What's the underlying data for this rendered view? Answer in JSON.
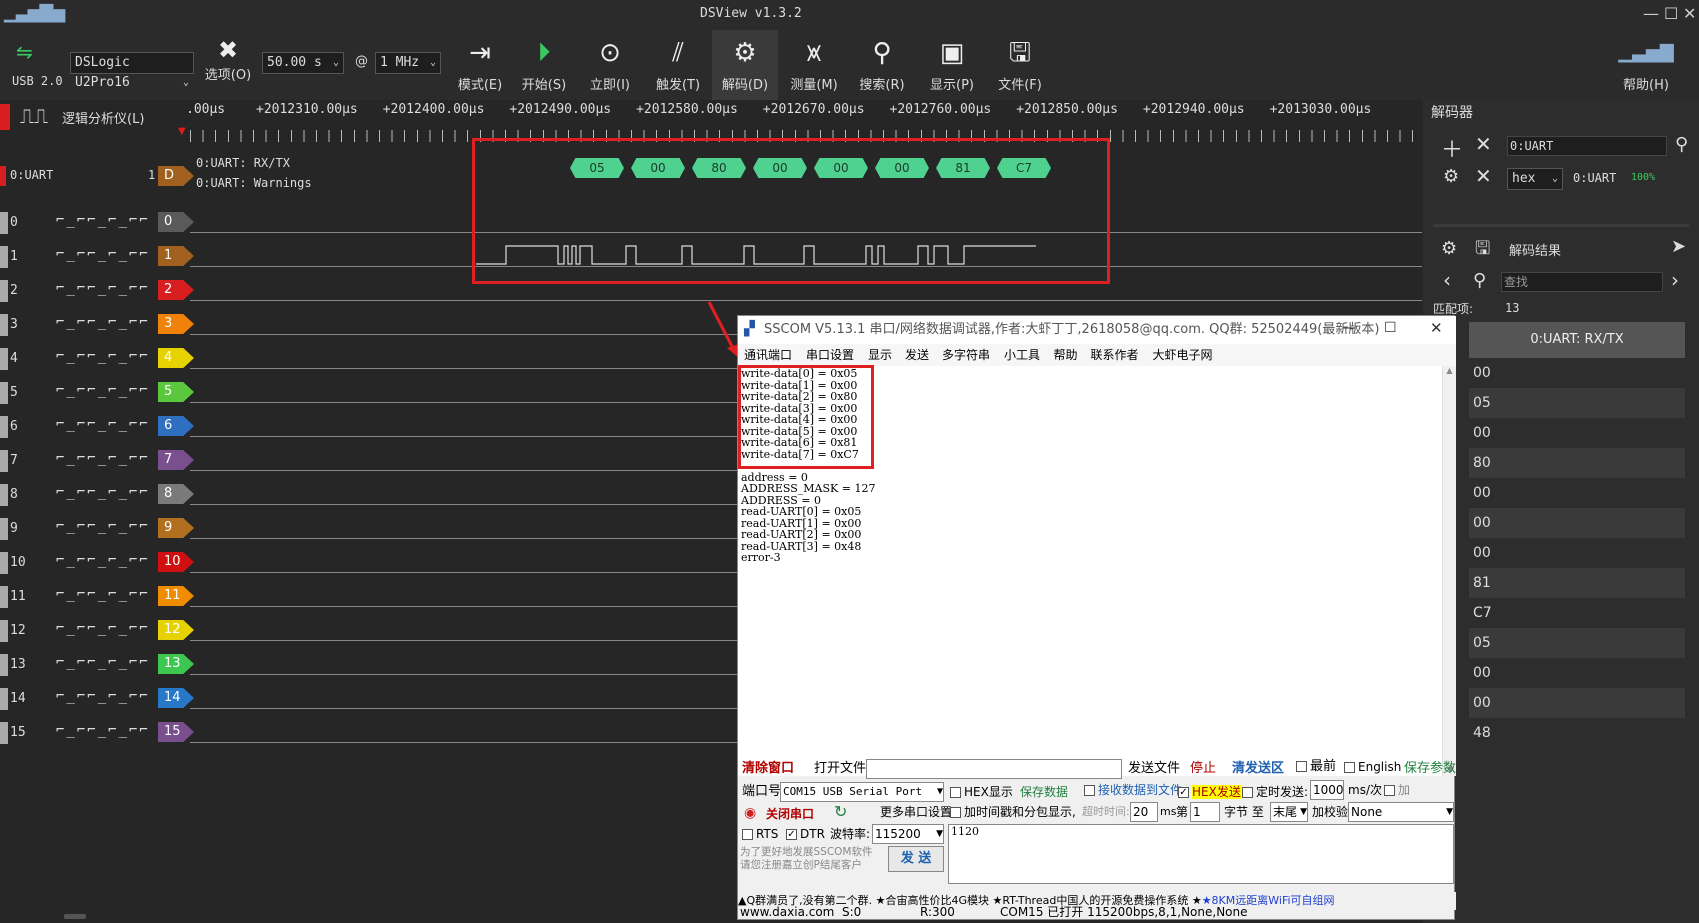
{
  "window": {
    "title": "DSView v1.3.2"
  },
  "toolbar": {
    "usb_label": "USB 2.0",
    "device": "DSLogic U2Pro16",
    "duration": "50.00 s",
    "at": "@",
    "rate": "1 MHz",
    "options": "选项(O)",
    "mode": "模式(E)",
    "start": "开始(S)",
    "instant": "立即(I)",
    "trigger": "触发(T)",
    "decode": "解码(D)",
    "measure": "测量(M)",
    "search": "搜索(R)",
    "display": "显示(P)",
    "file": "文件(F)",
    "help": "帮助(H)"
  },
  "left": {
    "analyzer_label": "逻辑分析仪(L)",
    "uart_channel": "0:UART",
    "uart_num": "1",
    "uart_tag": "D",
    "decoder_rows": [
      "0:UART: RX/TX",
      "0:UART: Warnings"
    ]
  },
  "timeaxis": {
    "ticks": [
      ".00μs",
      "+2012310.00μs",
      "+2012400.00μs",
      "+2012490.00μs",
      "+2012580.00μs",
      "+2012670.00μs",
      "+2012760.00μs",
      "+2012850.00μs",
      "+2012940.00μs",
      "+2013030.00μs"
    ]
  },
  "channels": [
    "0",
    "1",
    "2",
    "3",
    "4",
    "5",
    "6",
    "7",
    "8",
    "9",
    "10",
    "11",
    "12",
    "13",
    "14",
    "15"
  ],
  "channel_colors": [
    "#5a5a5a",
    "#a0611e",
    "#d81e1e",
    "#f0820a",
    "#e6d200",
    "#5ac83c",
    "#2e6fbf",
    "#7a4f8e",
    "#7a7a7a",
    "#b07020",
    "#d01010",
    "#f08c00",
    "#e6d200",
    "#3cc850",
    "#2878c8",
    "#7a4f8e"
  ],
  "trigger_icons": "⌐_⌐⌐_⌐_⌐⌐",
  "decoded_bytes": [
    "05",
    "00",
    "80",
    "00",
    "00",
    "00",
    "81",
    "C7"
  ],
  "right": {
    "title": "解码器",
    "decoder_name": "0:UART",
    "format": "hex",
    "format_channel": "0:UART",
    "progress": "100%",
    "result_title": "解码结果",
    "search_placeholder": "查找",
    "match_label": "匹配项:",
    "match_count": "13",
    "column_header": "0:UART: RX/TX",
    "rows": [
      "00",
      "05",
      "00",
      "80",
      "00",
      "00",
      "00",
      "81",
      "C7",
      "05",
      "00",
      "00",
      "48"
    ]
  },
  "sscom": {
    "title": "SSCOM V5.13.1 串口/网络数据调试器,作者:大虾丁丁,2618058@qq.com. QQ群: 52502449(最新版本)",
    "menu": [
      "通讯端口",
      "串口设置",
      "显示",
      "发送",
      "多字符串",
      "小工具",
      "帮助",
      "联系作者",
      "大虾电子网"
    ],
    "lines": [
      "write-data[0] = 0x05",
      "write-data[1] = 0x00",
      "write-data[2] = 0x80",
      "write-data[3] = 0x00",
      "write-data[4] = 0x00",
      "write-data[5] = 0x00",
      "write-data[6] = 0x81",
      "write-data[7] = 0xC7",
      "",
      "address = 0",
      "ADDRESS_MASK = 127",
      "ADDRESS = 0",
      "read-UART[0] = 0x05",
      "read-UART[1] = 0x00",
      "read-UART[2] = 0x00",
      "read-UART[3] = 0x48",
      "error-3"
    ],
    "clear_window": "清除窗口",
    "open_file": "打开文件",
    "send_file": "发送文件",
    "stop": "停止",
    "clear_send": "清发送区",
    "topmost": "最前",
    "english": "English",
    "save_params": "保存参数",
    "port_label": "端口号",
    "port_value": "COM15 USB Serial Port",
    "hex_display": "HEX显示",
    "save_data": "保存数据",
    "recv_to_file": "接收数据到文件",
    "hex_send": "HEX发送",
    "timed_send": "定时发送:",
    "interval": "1000",
    "interval_unit": "ms/次",
    "add": "加",
    "close_port": "关闭串口",
    "more_settings": "更多串口设置",
    "timestamp": "加时间戳和分包显示,",
    "timeout_label": "超时时间:",
    "timeout": "20",
    "ms": "ms",
    "nth": "第",
    "byte_from": "1",
    "byte_label": "字节 至",
    "byte_to": "末尾",
    "checksum_label": "加校验",
    "checksum": "None",
    "rts": "RTS",
    "dtr": "DTR",
    "baud_label": "波特率:",
    "baud": "115200",
    "send_text": "1120",
    "promo": "为了更好地发展SSCOM软件\n请您注册嘉立创P结尾客户",
    "send_btn": "发 送",
    "ticker": "▲Q群满员了,没有第二个群. ★合宙高性价比4G模块 ★RT-Thread中国人的开源免费操作系统 ★",
    "ticker_link": "★8KM远距离WiFi可自组网",
    "status_site": "www.daxia.com",
    "status_s": "S:0",
    "status_r": "R:300",
    "status_port": "COM15 已打开  115200bps,8,1,None,None"
  }
}
